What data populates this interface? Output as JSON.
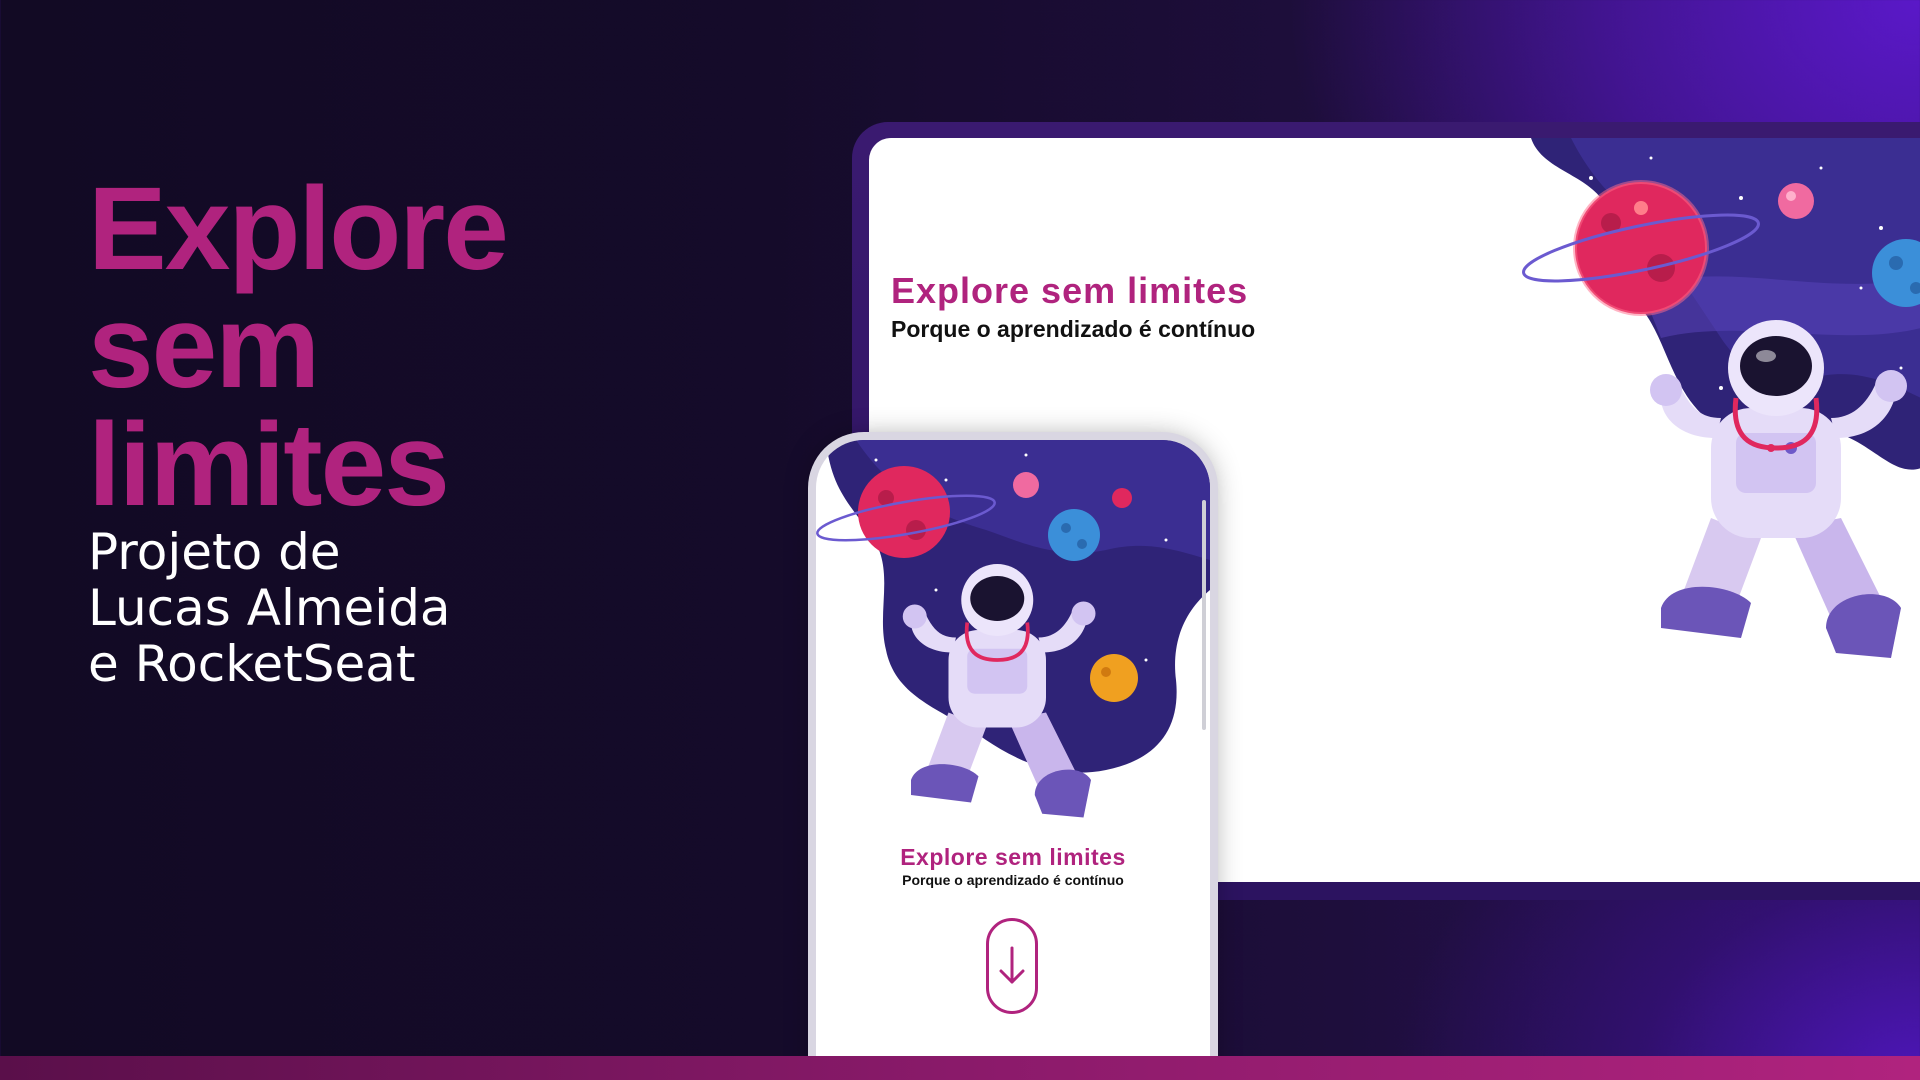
{
  "hero": {
    "title": "Explore\nsem\nlimites",
    "credit": "Projeto de\nLucas Almeida\ne RocketSeat"
  },
  "desktop": {
    "heading": "Explore sem limites",
    "subheading": "Porque o aprendizado é contínuo",
    "illustration_icon": "astronaut-space-illustration"
  },
  "phone": {
    "heading": "Explore sem limites",
    "subheading": "Porque o aprendizado é contínuo",
    "illustration_icon": "astronaut-space-illustration",
    "scroll_icon": "arrow-down-icon"
  },
  "colors": {
    "accent": "#b0237e",
    "text_light": "#ffffff",
    "space_dark": "#2a1f6e",
    "space_mid": "#3d2f92"
  }
}
